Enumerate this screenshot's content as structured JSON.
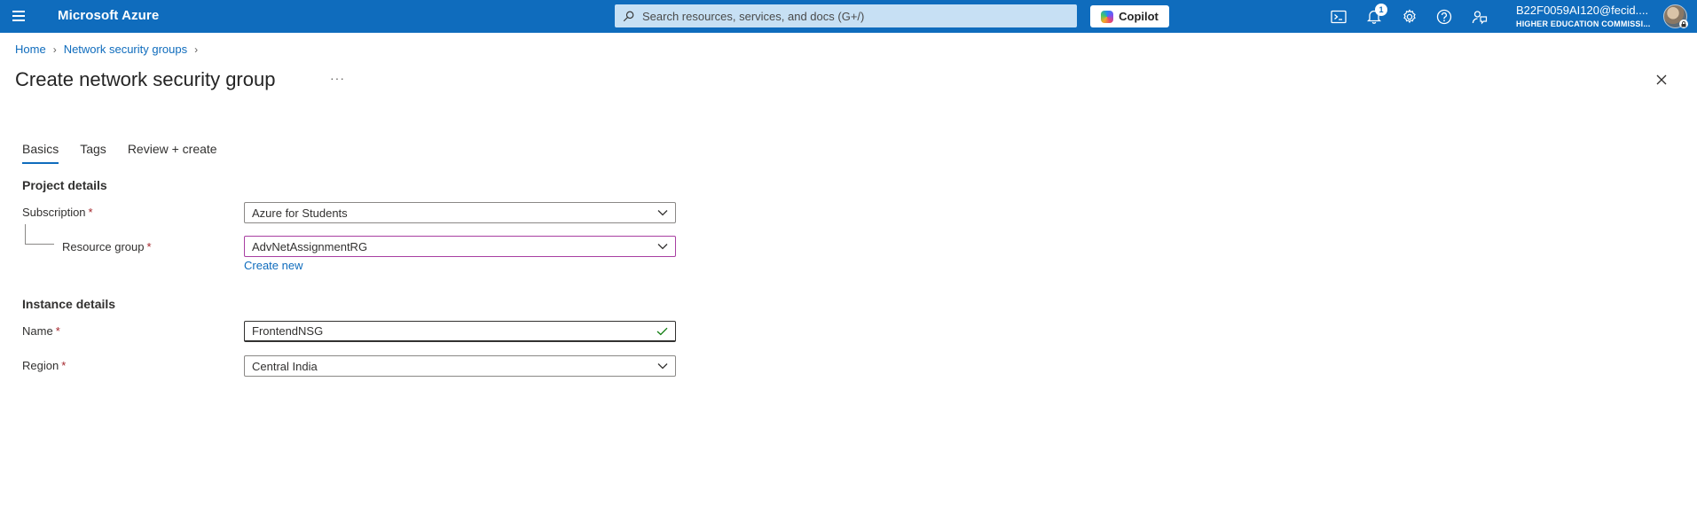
{
  "topbar": {
    "brand": "Microsoft Azure",
    "search_placeholder": "Search resources, services, and docs (G+/)",
    "copilot_label": "Copilot",
    "notification_count": "1",
    "account_user": "B22F0059AI120@fecid....",
    "account_tenant": "HIGHER EDUCATION COMMISSI..."
  },
  "breadcrumb": {
    "items": [
      "Home",
      "Network security groups"
    ]
  },
  "page": {
    "title": "Create network security group",
    "more": "···"
  },
  "tabs": [
    {
      "label": "Basics",
      "active": true
    },
    {
      "label": "Tags",
      "active": false
    },
    {
      "label": "Review + create",
      "active": false
    }
  ],
  "project_details": {
    "heading": "Project details",
    "subscription_label": "Subscription",
    "subscription_value": "Azure for Students",
    "resource_group_label": "Resource group",
    "resource_group_value": "AdvNetAssignmentRG",
    "create_new": "Create new"
  },
  "instance_details": {
    "heading": "Instance details",
    "name_label": "Name",
    "name_value": "FrontendNSG",
    "region_label": "Region",
    "region_value": "Central India"
  },
  "required_marker": "*",
  "colors": {
    "topbar": "#0f6cbd",
    "link": "#0f6cbd",
    "required": "#a4262c",
    "focus_border": "#a83fa2",
    "valid_check": "#107c10"
  }
}
